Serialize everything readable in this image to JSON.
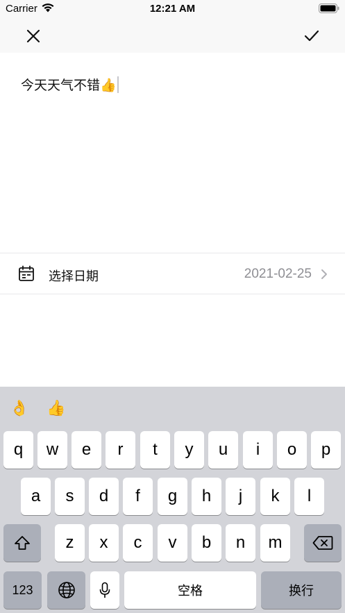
{
  "status_bar": {
    "carrier": "Carrier",
    "time": "12:21 AM",
    "wifi_icon": "wifi-icon",
    "battery_icon": "battery-icon"
  },
  "nav": {
    "close_icon": "close-icon",
    "confirm_icon": "checkmark-icon"
  },
  "note": {
    "text": "今天天气不错👍"
  },
  "date_row": {
    "icon": "calendar-icon",
    "label": "选择日期",
    "value": "2021-02-25"
  },
  "keyboard": {
    "suggestions": [
      "👌",
      "👍"
    ],
    "row1": [
      "q",
      "w",
      "e",
      "r",
      "t",
      "y",
      "u",
      "i",
      "o",
      "p"
    ],
    "row2": [
      "a",
      "s",
      "d",
      "f",
      "g",
      "h",
      "j",
      "k",
      "l"
    ],
    "row3": [
      "z",
      "x",
      "c",
      "v",
      "b",
      "n",
      "m"
    ],
    "numbers_label": "123",
    "space_label": "空格",
    "return_label": "换行",
    "shift_icon": "shift-icon",
    "delete_icon": "delete-icon",
    "globe_icon": "globe-icon",
    "mic_icon": "microphone-icon",
    "colors": {
      "background": "#d3d4d9",
      "key": "#ffffff",
      "function_key": "#abafb9"
    }
  }
}
